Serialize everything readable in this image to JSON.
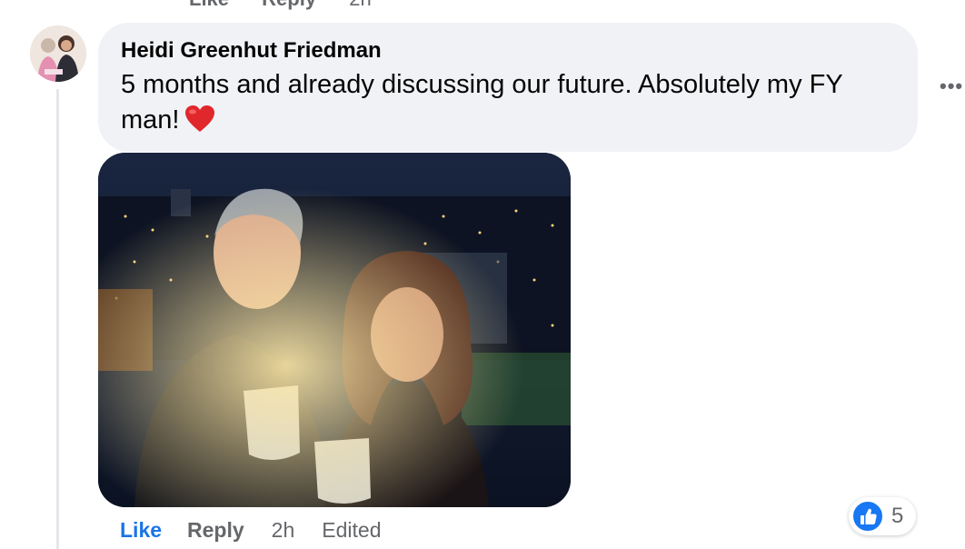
{
  "previous_comment": {
    "like_label": "Like",
    "reply_label": "Reply",
    "time": "2h"
  },
  "comment": {
    "author": "Heidi Greenhut Friedman",
    "text": "5 months and already discussing our future. Absolutely my FY man!",
    "emoji": "heart",
    "more_label": "•••",
    "actions": {
      "like": "Like",
      "reply": "Reply",
      "time": "2h",
      "edited": "Edited"
    },
    "reactions": {
      "icon": "thumbs-up-icon",
      "count": "5"
    }
  },
  "colors": {
    "link_blue": "#1b74e4",
    "bubble_bg": "#f0f2f5",
    "secondary": "#65676b",
    "heart_red": "#e0272c"
  }
}
